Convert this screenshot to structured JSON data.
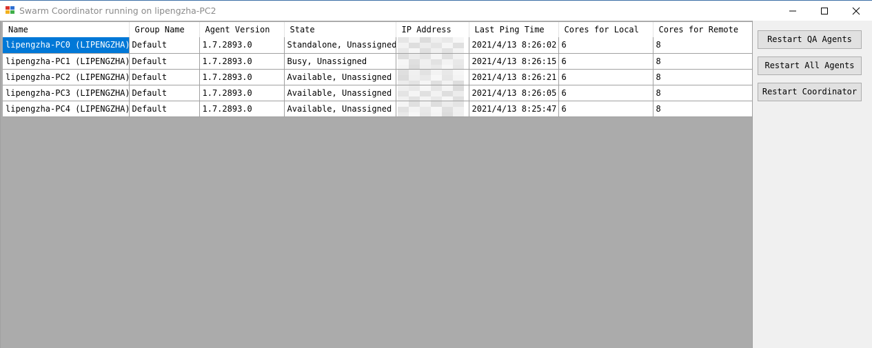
{
  "window": {
    "title": "Swarm Coordinator running on lipengzha-PC2"
  },
  "table": {
    "columns": [
      "Name",
      "Group Name",
      "Agent Version",
      "State",
      "IP Address",
      "Last Ping Time",
      "Cores for Local",
      "Cores for Remote"
    ],
    "rows": [
      [
        "lipengzha-PC0 (LIPENGZHA)",
        "Default",
        "1.7.2893.0",
        "Standalone, Unassigned",
        "",
        "2021/4/13 8:26:02",
        "6",
        "8"
      ],
      [
        "lipengzha-PC1 (LIPENGZHA)",
        "Default",
        "1.7.2893.0",
        "Busy, Unassigned",
        "",
        "2021/4/13 8:26:15",
        "6",
        "8"
      ],
      [
        "lipengzha-PC2 (LIPENGZHA)",
        "Default",
        "1.7.2893.0",
        "Available, Unassigned",
        "",
        "2021/4/13 8:26:21",
        "6",
        "8"
      ],
      [
        "lipengzha-PC3 (LIPENGZHA)",
        "Default",
        "1.7.2893.0",
        "Available, Unassigned",
        "",
        "2021/4/13 8:26:05",
        "6",
        "8"
      ],
      [
        "lipengzha-PC4 (LIPENGZHA)",
        "Default",
        "1.7.2893.0",
        "Available, Unassigned",
        "",
        "2021/4/13 8:25:47",
        "6",
        "8"
      ]
    ],
    "selected_row": 0,
    "ip_address_state": "blurred"
  },
  "buttons": {
    "restart_qa": "Restart QA Agents",
    "restart_all": "Restart All Agents",
    "restart_coordinator": "Restart Coordinator"
  },
  "colors": {
    "selection": "#0078d7",
    "grid_background": "#ababab",
    "title_text": "#8a8a8a"
  }
}
